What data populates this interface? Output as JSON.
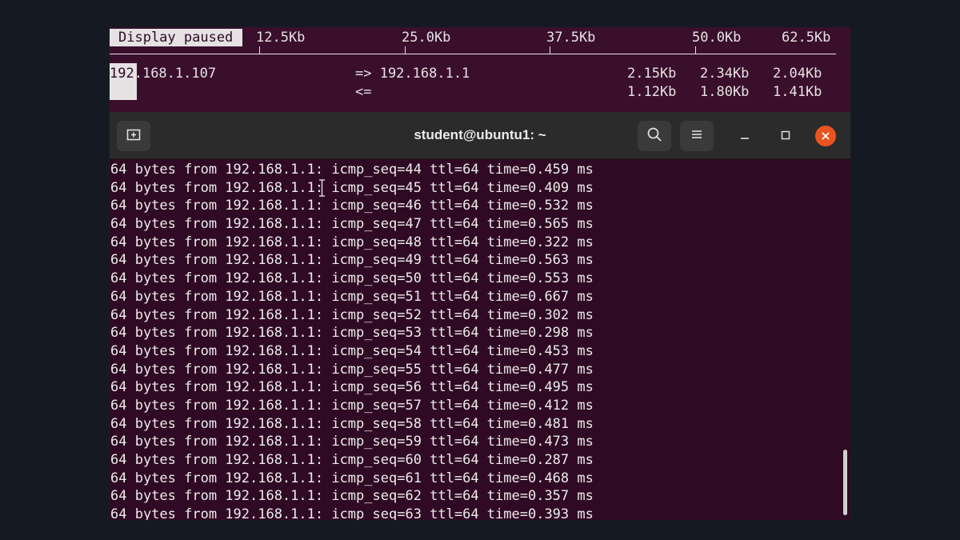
{
  "iftop": {
    "paused_label": "Display paused",
    "scale": [
      "12.5Kb",
      "25.0Kb",
      "37.5Kb",
      "50.0Kb",
      "62.5Kb"
    ],
    "row": {
      "src_highlight": "192",
      "src_rest": ".168.1.107",
      "dst": "=> 192.168.1.1",
      "dir_in": "<=",
      "out_rates": [
        "2.15Kb",
        "2.34Kb",
        "2.04Kb"
      ],
      "in_rates": [
        "1.12Kb",
        "1.80Kb",
        "1.41Kb"
      ]
    }
  },
  "window": {
    "title": "student@ubuntu1: ~",
    "icons": {
      "new_tab": "new-tab-icon",
      "search": "search-icon",
      "menu": "hamburger-menu-icon",
      "minimize": "minimize-icon",
      "maximize": "maximize-icon",
      "close": "close-icon"
    },
    "accent_close": "#e95420"
  },
  "terminal": {
    "background": "#300a24",
    "lines": [
      "64 bytes from 192.168.1.1: icmp_seq=44 ttl=64 time=0.459 ms",
      "64 bytes from 192.168.1.1: icmp_seq=45 ttl=64 time=0.409 ms",
      "64 bytes from 192.168.1.1: icmp_seq=46 ttl=64 time=0.532 ms",
      "64 bytes from 192.168.1.1: icmp_seq=47 ttl=64 time=0.565 ms",
      "64 bytes from 192.168.1.1: icmp_seq=48 ttl=64 time=0.322 ms",
      "64 bytes from 192.168.1.1: icmp_seq=49 ttl=64 time=0.563 ms",
      "64 bytes from 192.168.1.1: icmp_seq=50 ttl=64 time=0.553 ms",
      "64 bytes from 192.168.1.1: icmp_seq=51 ttl=64 time=0.667 ms",
      "64 bytes from 192.168.1.1: icmp_seq=52 ttl=64 time=0.302 ms",
      "64 bytes from 192.168.1.1: icmp_seq=53 ttl=64 time=0.298 ms",
      "64 bytes from 192.168.1.1: icmp_seq=54 ttl=64 time=0.453 ms",
      "64 bytes from 192.168.1.1: icmp_seq=55 ttl=64 time=0.477 ms",
      "64 bytes from 192.168.1.1: icmp_seq=56 ttl=64 time=0.495 ms",
      "64 bytes from 192.168.1.1: icmp_seq=57 ttl=64 time=0.412 ms",
      "64 bytes from 192.168.1.1: icmp_seq=58 ttl=64 time=0.481 ms",
      "64 bytes from 192.168.1.1: icmp_seq=59 ttl=64 time=0.473 ms",
      "64 bytes from 192.168.1.1: icmp_seq=60 ttl=64 time=0.287 ms",
      "64 bytes from 192.168.1.1: icmp_seq=61 ttl=64 time=0.468 ms",
      "64 bytes from 192.168.1.1: icmp_seq=62 ttl=64 time=0.357 ms",
      "64 bytes from 192.168.1.1: icmp_seq=63 ttl=64 time=0.393 ms"
    ]
  }
}
